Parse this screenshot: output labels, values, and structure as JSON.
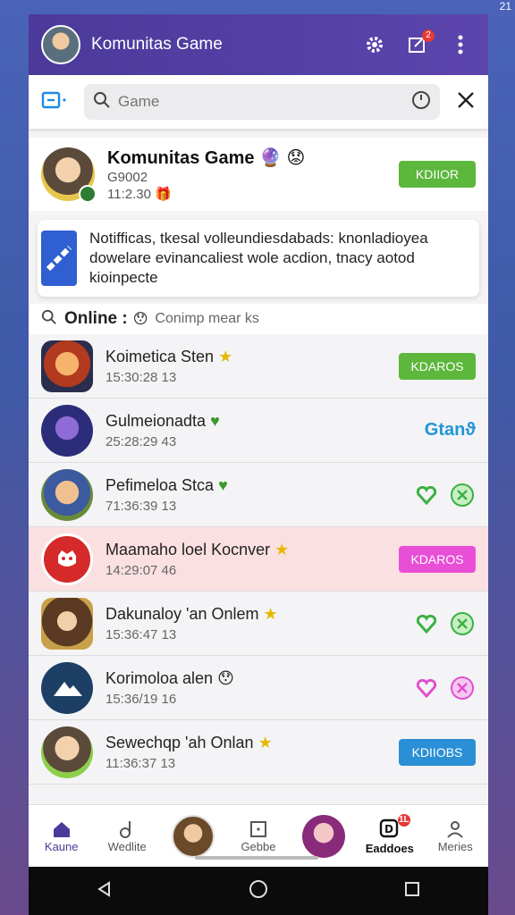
{
  "status": {
    "time": "21"
  },
  "appbar": {
    "title": "Komunitas Game",
    "badge": "2"
  },
  "search": {
    "placeholder": "Game"
  },
  "community": {
    "name": "Komunitas Game",
    "id": "G9002",
    "time": "11:2.30",
    "button": "KDIIOR"
  },
  "notice": {
    "text": "Notifficas, tkesal volleundiesdabads: knonladioyea dowelare evinancaliest wole acdion, tnacy aotod kioinpecte"
  },
  "online": {
    "label": "Online :",
    "sub": "Conimp mear ks"
  },
  "players": [
    {
      "name": "Koimetica Sten",
      "time": "15:30:28 13",
      "badge": "★",
      "action": "KDAROS",
      "action_type": "green"
    },
    {
      "name": "Gulmeionadta",
      "time": "25:28:29 43",
      "badge": "♥",
      "action": "Gtanϑ",
      "action_type": "brand"
    },
    {
      "name": "Pefimeloa Stca",
      "time": "71:36:39 13",
      "badge": "♥",
      "action": "",
      "action_type": "hearts-green"
    },
    {
      "name": "Maamaho loel Kocnver",
      "time": "14:29:07 46",
      "badge": "★",
      "action": "KDAROS",
      "action_type": "pink"
    },
    {
      "name": "Dakunaloy 'an Onlem",
      "time": "15:36:47 13",
      "badge": "★",
      "action": "",
      "action_type": "hearts-green"
    },
    {
      "name": "Korimoloa alen",
      "time": "15:36/19 16",
      "badge": "😯",
      "action": "",
      "action_type": "hearts-pink"
    },
    {
      "name": "Sewechqp 'ah Onlan",
      "time": "11:36:37 13",
      "badge": "★",
      "action": "KDIIOBS",
      "action_type": "blue"
    }
  ],
  "nav": {
    "home": "Kaune",
    "wedite": "Wedlite",
    "gebbe": "Gebbe",
    "eaddoes": "Eaddoes",
    "eaddoes_badge": "1L",
    "meries": "Meries"
  }
}
